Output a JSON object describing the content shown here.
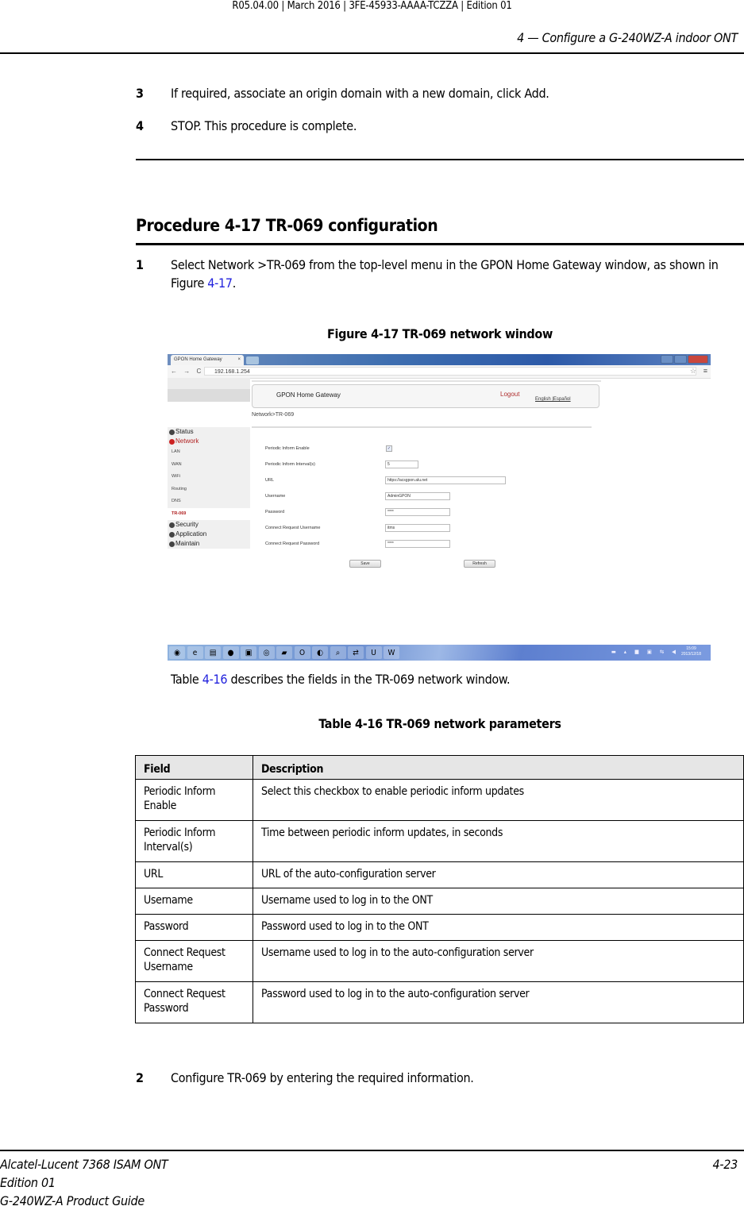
{
  "running_header": {
    "doc_info": "R05.04.00 | March 2016 | 3FE-45933-AAAA-TCZZA | Edition 01",
    "chapter": "4 — Configure a G-240WZ-A indoor ONT"
  },
  "prev_steps": [
    {
      "num": "3",
      "text": "If required, associate an origin domain with a new domain, click Add."
    },
    {
      "num": "4",
      "text": "STOP. This procedure is complete."
    }
  ],
  "procedure": {
    "title": "Procedure 4-17  TR-069 configuration",
    "step1": {
      "num": "1",
      "text_before": "Select Network >TR-069 from the top-level menu in the GPON Home Gateway window, as shown in Figure ",
      "link": "4-17",
      "text_after": "."
    },
    "step2": {
      "num": "2",
      "text": "Configure TR-069 by entering the required information."
    }
  },
  "figure": {
    "title": "Figure 4-17  TR-069 network window",
    "browser": {
      "tab_title": "GPON Home Gateway",
      "tab_close": "×",
      "address": "192.168.1.254",
      "nav_icons": "← → C",
      "star": "☆",
      "menu": "≡"
    },
    "gateway": {
      "title": "GPON Home Gateway",
      "logout": "Logout",
      "languages": "English |Español",
      "breadcrumb": "Network>TR-069",
      "sidebar": [
        {
          "label": "Status",
          "state": "collapsed"
        },
        {
          "label": "Network",
          "state": "expanded",
          "children": [
            "LAN",
            "WAN",
            "WiFi",
            "Routing",
            "DNS",
            "TR-069"
          ],
          "active_child": "TR-069"
        },
        {
          "label": "Security",
          "state": "collapsed"
        },
        {
          "label": "Application",
          "state": "collapsed"
        },
        {
          "label": "Maintain",
          "state": "collapsed"
        }
      ],
      "form": {
        "fields": [
          {
            "label": "Periodic Inform Enable",
            "type": "checkbox",
            "checked": true,
            "value": "✓"
          },
          {
            "label": "Periodic Inform Interval(s)",
            "type": "text",
            "value": "5"
          },
          {
            "label": "URL",
            "type": "text",
            "value": "https://acsgpon.alu.net"
          },
          {
            "label": "Username",
            "type": "text",
            "value": "AdminGPON"
          },
          {
            "label": "Password",
            "type": "password",
            "value": "****"
          },
          {
            "label": "Connect Request Username",
            "type": "text",
            "value": "itms"
          },
          {
            "label": "Connect Request Password",
            "type": "password",
            "value": "****"
          }
        ],
        "save_label": "Save",
        "refresh_label": "Refresh"
      }
    },
    "taskbar": {
      "icons": [
        "start-orb",
        "internet-explorer",
        "file-explorer",
        "firefox",
        "control-panel",
        "chrome",
        "notebook",
        "outlook",
        "network-tool",
        "search-user",
        "sync-tool",
        "ultraedit",
        "word"
      ],
      "glyphs": [
        "◉",
        "e",
        "▤",
        "●",
        "▣",
        "◎",
        "▰",
        "O",
        "◐",
        "⌕",
        "⇄",
        "U",
        "W"
      ],
      "tray": "▬ ▴ ■ ▣ ⇆ ◀",
      "time": "15:09",
      "date": "2013/12/18"
    }
  },
  "caption": {
    "text_before": "Table ",
    "link": "4-16",
    "text_after": " describes the fields in the TR-069 network window."
  },
  "table": {
    "title": "Table 4-16 TR-069 network parameters",
    "headers": [
      "Field",
      "Description"
    ],
    "rows": [
      {
        "field": "Periodic Inform Enable",
        "description": "Select this checkbox to enable periodic inform updates"
      },
      {
        "field": "Periodic Inform Interval(s)",
        "description": "Time between periodic inform updates, in seconds"
      },
      {
        "field": "URL",
        "description": "URL of the auto-configuration server"
      },
      {
        "field": "Username",
        "description": "Username used to log in to the ONT"
      },
      {
        "field": "Password",
        "description": "Password used to log in to the ONT"
      },
      {
        "field": "Connect Request Username",
        "description": "Username used to log in to the auto-configuration server"
      },
      {
        "field": "Connect Request Password",
        "description": "Password used to log in to the auto-configuration server"
      }
    ]
  },
  "footer": {
    "product": "Alcatel-Lucent 7368 ISAM ONT",
    "edition": "Edition 01",
    "guide": "G-240WZ-A Product Guide",
    "page": "4-23"
  },
  "colors": {
    "link": "#2222dd",
    "logout": "#b03030",
    "table_header_bg": "#e6e6e6"
  }
}
